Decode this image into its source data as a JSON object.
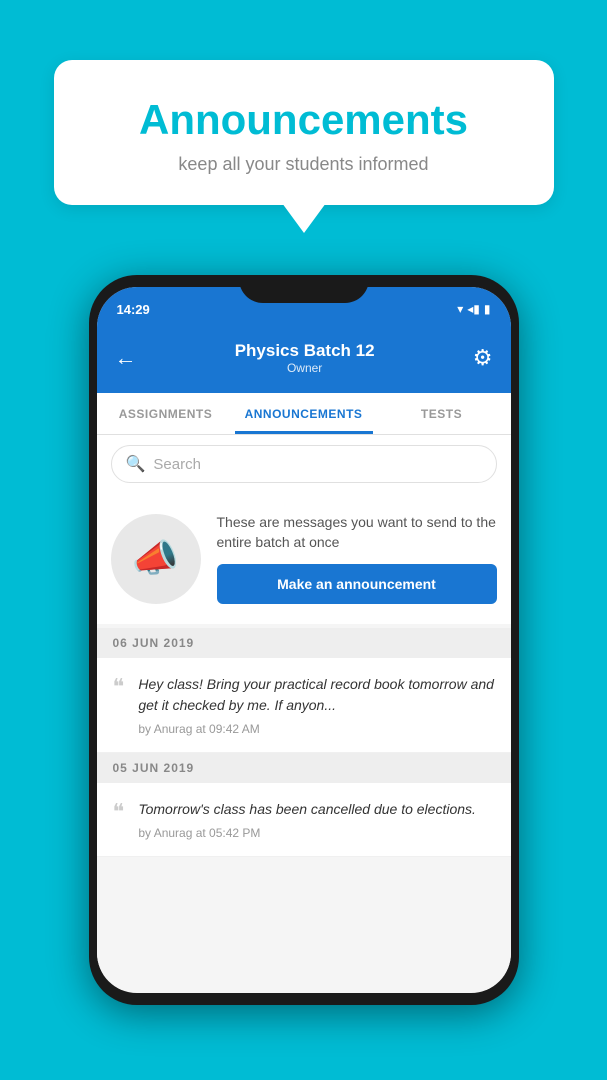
{
  "background_color": "#00BCD4",
  "speech_bubble": {
    "title": "Announcements",
    "subtitle": "keep all your students informed"
  },
  "phone": {
    "status_bar": {
      "time": "14:29",
      "icons": [
        "▾",
        "◂",
        "▮"
      ]
    },
    "app_bar": {
      "title": "Physics Batch 12",
      "subtitle": "Owner",
      "back_label": "←",
      "settings_label": "⚙"
    },
    "tabs": [
      {
        "label": "ASSIGNMENTS",
        "active": false
      },
      {
        "label": "ANNOUNCEMENTS",
        "active": true
      },
      {
        "label": "TESTS",
        "active": false
      }
    ],
    "search": {
      "placeholder": "Search"
    },
    "promo": {
      "text": "These are messages you want to send to the entire batch at once",
      "button_label": "Make an announcement"
    },
    "announcements": [
      {
        "date_header": "06  JUN  2019",
        "text": "Hey class! Bring your practical record book tomorrow and get it checked by me. If anyon...",
        "meta": "by Anurag at 09:42 AM"
      },
      {
        "date_header": "05  JUN  2019",
        "text": "Tomorrow's class has been cancelled due to elections.",
        "meta": "by Anurag at 05:42 PM"
      }
    ]
  }
}
